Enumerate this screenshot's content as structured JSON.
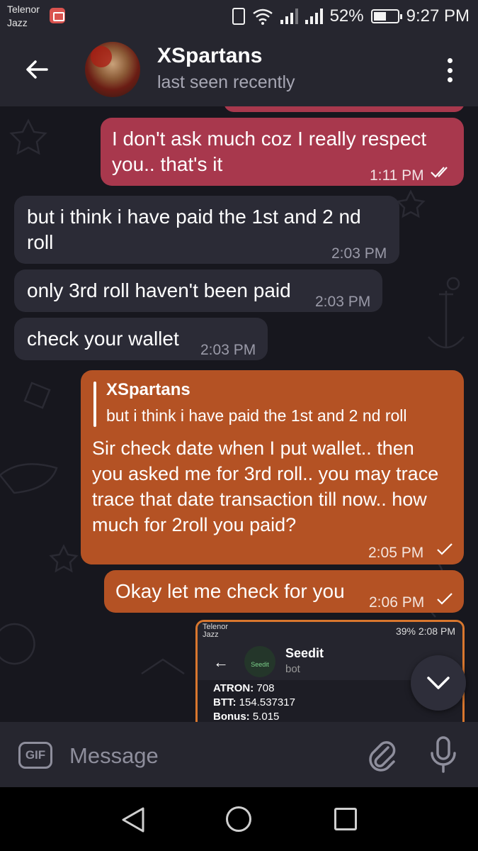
{
  "status_bar": {
    "carrier_line1": "Telenor",
    "carrier_line2": "Jazz",
    "battery_percent": "52%",
    "battery_level": 0.52,
    "time": "9:27 PM"
  },
  "header": {
    "title": "XSpartans",
    "subtitle": "last seen recently",
    "avatar": "spartan-avatar"
  },
  "messages": [
    {
      "direction": "out",
      "text": "I don't ask much coz I really respect you.. that's it",
      "time": "1:11 PM",
      "status": "double-check"
    },
    {
      "direction": "in",
      "text": "but i think i have paid the 1st and 2 nd roll",
      "time": "2:03 PM"
    },
    {
      "direction": "in",
      "text": "only 3rd roll haven't been paid",
      "time": "2:03 PM"
    },
    {
      "direction": "in",
      "text": "check your wallet",
      "time": "2:03 PM"
    },
    {
      "direction": "out",
      "reply_to": {
        "name": "XSpartans",
        "text": "but i think i have paid the 1st and 2 nd roll"
      },
      "text": "Sir check date when I put wallet.. then you asked me for 3rd roll.. you may trace trace that date transaction till now.. how much for 2roll you paid?",
      "time": "2:05 PM",
      "status": "single-check"
    },
    {
      "direction": "out",
      "text": "Okay let me check for you",
      "time": "2:06 PM",
      "status": "single-check"
    }
  ],
  "screenshot_message": {
    "carrier_line1": "Telenor",
    "carrier_line2": "Jazz",
    "status_right": "39% 2:08 PM",
    "bot_logo_text": "Seedit",
    "bot_name": "Seedit",
    "bot_label": "bot",
    "atron_label": "ATRON:",
    "atron_value": "708",
    "btt_label": "BTT:",
    "btt_value": "154.537317",
    "bonus_label": "Bonus:",
    "bonus_value": "5.015"
  },
  "input_bar": {
    "gif_label": "GIF",
    "placeholder": "Message"
  },
  "colors": {
    "outgoing_red": "#a8384d",
    "outgoing_orange": "#b45224",
    "incoming": "#2b2b36",
    "background": "#17171e"
  }
}
